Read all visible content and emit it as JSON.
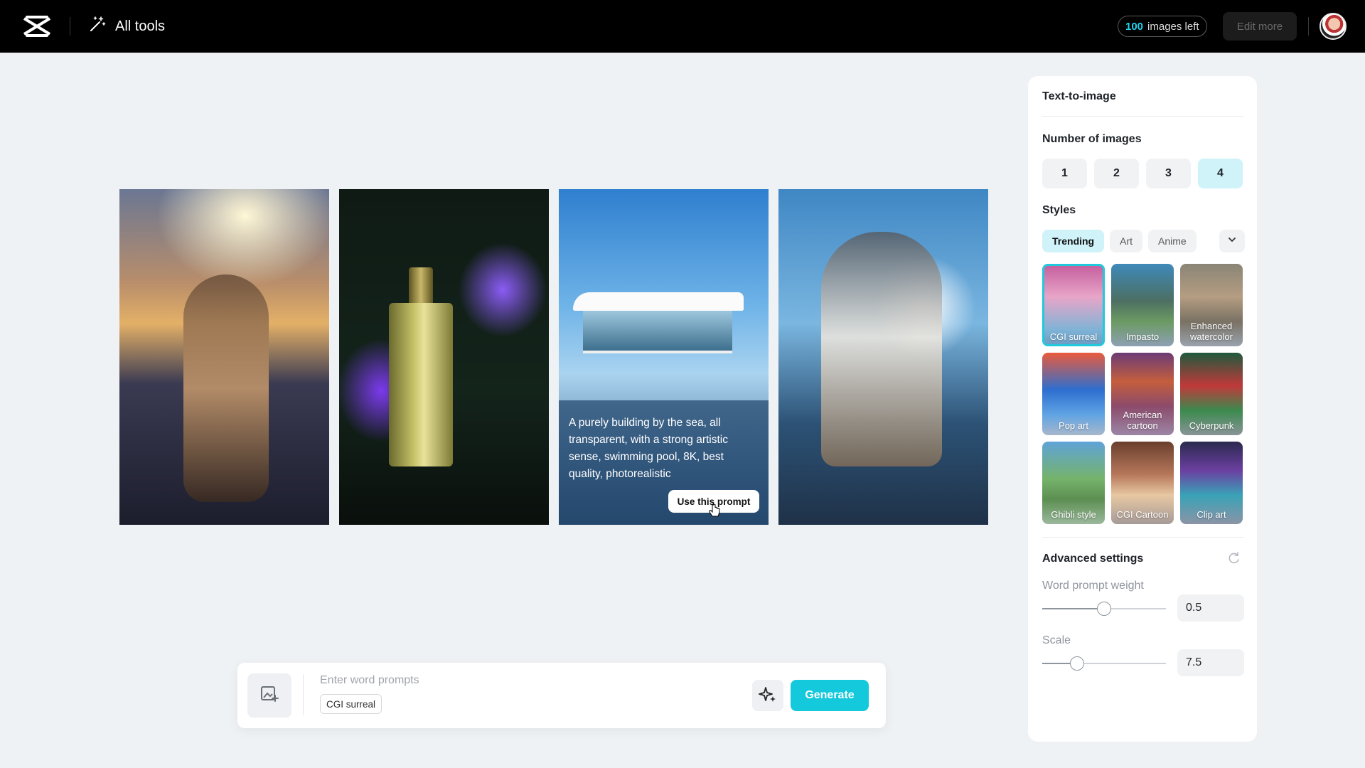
{
  "topbar": {
    "brand_icon": "capcut-logo-icon",
    "all_tools_label": "All tools",
    "credits_count": "100",
    "credits_suffix": "images left",
    "edit_more_label": "Edit more"
  },
  "gallery": {
    "images": [
      {
        "name": "cat-mountain-sunset"
      },
      {
        "name": "perfume-bottle-flowers"
      },
      {
        "name": "glass-house-by-sea"
      },
      {
        "name": "cat-window-sky"
      }
    ],
    "hover_prompt_text": "A purely building by the sea, all transparent, with a strong artistic sense, swimming pool, 8K, best quality, photorealistic",
    "use_prompt_label": "Use this prompt"
  },
  "prompt_bar": {
    "placeholder": "Enter word prompts",
    "style_chip": "CGI surreal",
    "generate_label": "Generate"
  },
  "panel": {
    "title": "Text-to-image",
    "number_of_images_label": "Number of images",
    "number_options": [
      "1",
      "2",
      "3",
      "4"
    ],
    "selected_number": "4",
    "styles_label": "Styles",
    "style_tabs": [
      "Trending",
      "Art",
      "Anime"
    ],
    "active_style_tab": "Trending",
    "styles": [
      {
        "label": "CGI surreal",
        "selected": true
      },
      {
        "label": "Impasto",
        "selected": false
      },
      {
        "label": "Enhanced watercolor",
        "selected": false
      },
      {
        "label": "Pop art",
        "selected": false
      },
      {
        "label": "American cartoon",
        "selected": false
      },
      {
        "label": "Cyberpunk",
        "selected": false
      },
      {
        "label": "Ghibli style",
        "selected": false
      },
      {
        "label": "CGI Cartoon",
        "selected": false
      },
      {
        "label": "Clip art",
        "selected": false
      }
    ],
    "advanced_label": "Advanced settings",
    "word_prompt_weight_label": "Word prompt weight",
    "word_prompt_weight_value": "0.5",
    "word_prompt_weight_fraction": 0.5,
    "scale_label": "Scale",
    "scale_value": "7.5",
    "scale_fraction": 0.28
  },
  "colors": {
    "accent": "#14c9dc",
    "accent_light": "#cff3f8",
    "credits_highlight": "#22d3ee",
    "page_bg": "#eff2f5"
  }
}
